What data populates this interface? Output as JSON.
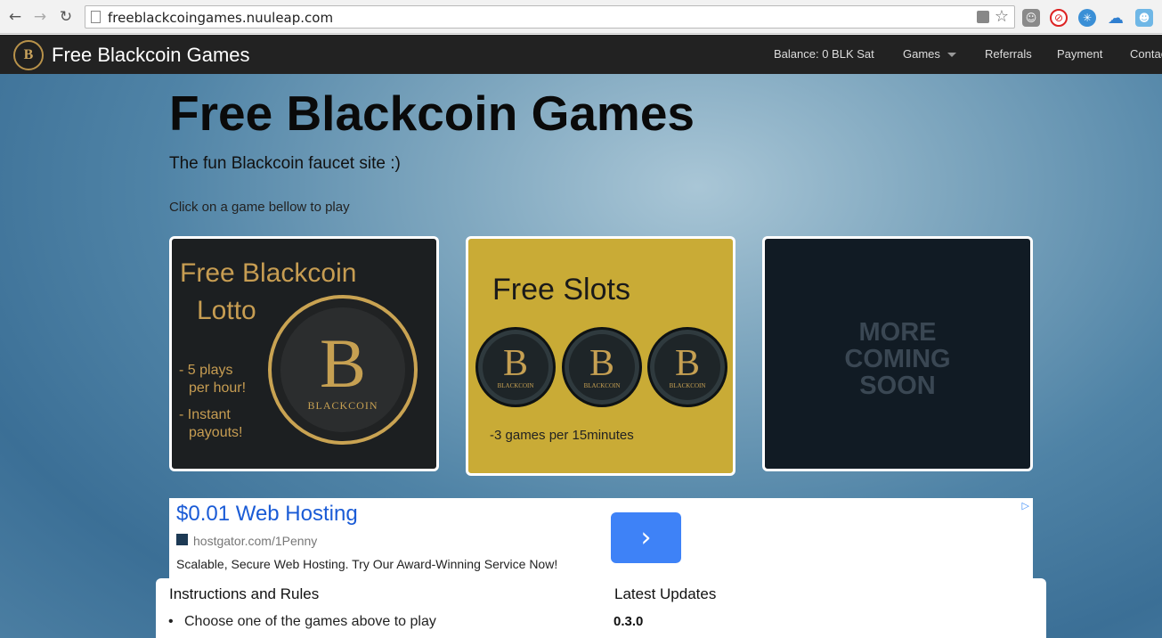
{
  "browser": {
    "url": "freeblackcoingames.nuuleap.com"
  },
  "navbar": {
    "brand": "Free Blackcoin Games",
    "logo_letter": "B",
    "balance": "Balance: 0 BLK Sat",
    "games": "Games",
    "referrals": "Referrals",
    "payment": "Payment",
    "contact": "Contac"
  },
  "hero": {
    "title": "Free Blackcoin Games",
    "tagline": "The fun Blackcoin faucet site :)",
    "hint": "Click on a game bellow to play"
  },
  "cards": {
    "lotto": {
      "title_line1": "Free Blackcoin",
      "title_line2": "Lotto",
      "bullet1a": "-  5  plays",
      "bullet1b": "per hour!",
      "bullet2a": "- Instant",
      "bullet2b": "payouts!",
      "coin_letter": "B",
      "coin_name": "BLACKCOIN"
    },
    "slots": {
      "title": "Free Slots",
      "coin_letter": "B",
      "coin_name": "BLACKCOIN",
      "footer": "-3 games per 15minutes"
    },
    "soon": {
      "line1": "MORE",
      "line2": "COMING",
      "line3": "SOON"
    }
  },
  "ad": {
    "title": "$0.01 Web Hosting",
    "url": "hostgator.com/1Penny",
    "description": "Scalable, Secure Web Hosting. Try Our Award-Winning Service Now!",
    "button_arrow": "›"
  },
  "panel": {
    "instructions_heading": "Instructions and Rules",
    "instruction1": "Choose one of the games above to play",
    "updates_heading": "Latest Updates",
    "version": "0.3.0"
  },
  "colors": {
    "navbar": "#222222",
    "gold": "#c79d52",
    "slots_bg": "#c9ab36",
    "ad_link": "#1a5bd6",
    "ad_button": "#3e82f7"
  }
}
